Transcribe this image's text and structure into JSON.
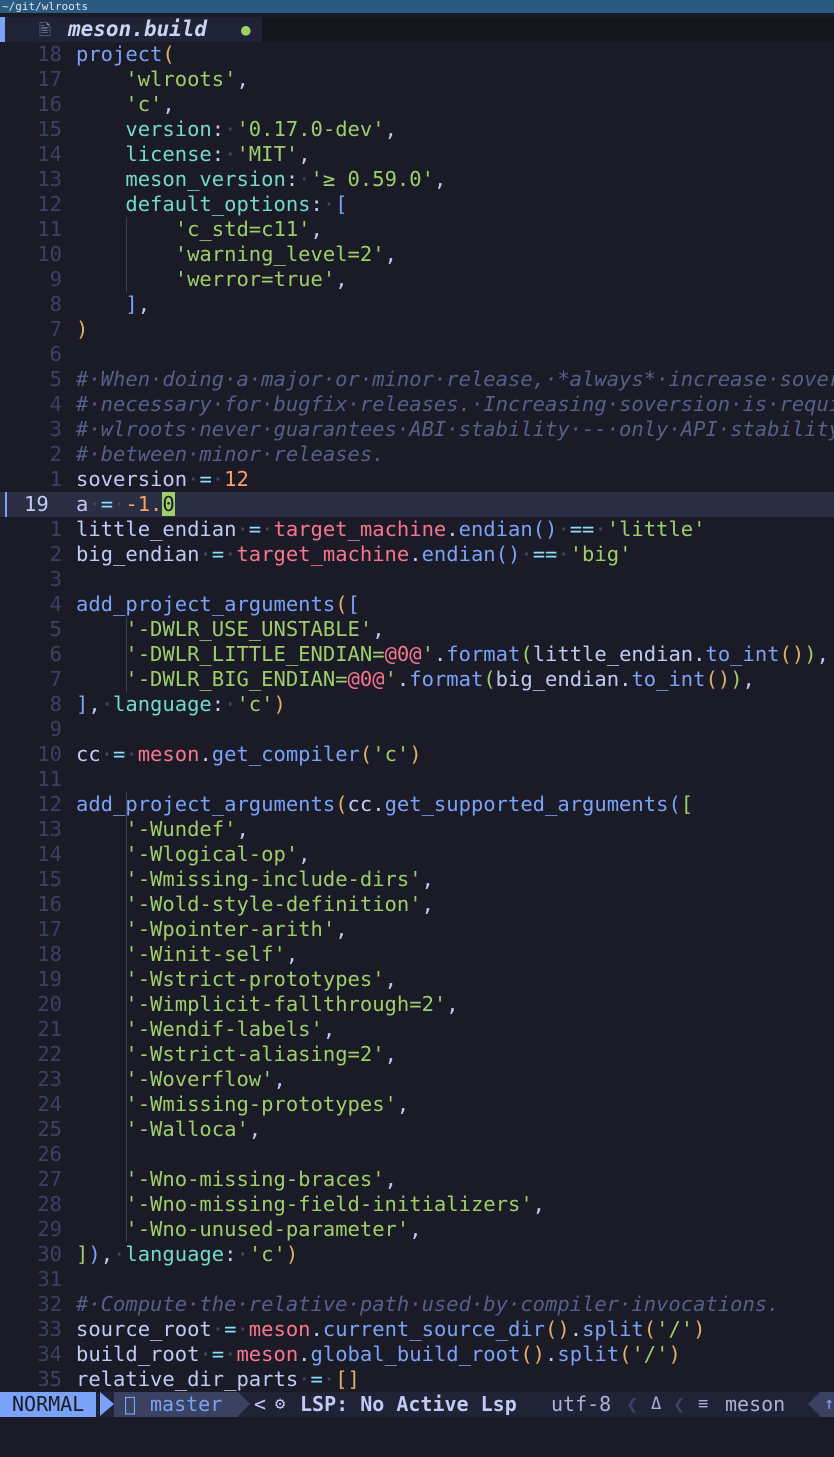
{
  "window": {
    "title": "~/git/wlroots"
  },
  "tab": {
    "file_icon": "🖹",
    "name": "meson.build",
    "modified": "●"
  },
  "lines": [
    {
      "ln": "18",
      "html": "<span class='fn'>project</span><span class='br'>(</span>"
    },
    {
      "ln": "17",
      "html": "    <span class='str'>'wlroots'</span>,"
    },
    {
      "ln": "16",
      "html": "    <span class='str'>'c'</span>,"
    },
    {
      "ln": "15",
      "html": "    <span class='key'>version</span>:<span class='dot'>·</span><span class='str'>'0.17.0-dev'</span>,"
    },
    {
      "ln": "14",
      "html": "    <span class='key'>license</span>:<span class='dot'>·</span><span class='str'>'MIT'</span>,"
    },
    {
      "ln": "13",
      "html": "    <span class='key'>meson_version</span>:<span class='dot'>·</span><span class='str'>'≥ 0.59.0'</span>,"
    },
    {
      "ln": "12",
      "html": "    <span class='key'>default_options</span>:<span class='dot'>·</span><span class='br2'>[</span>"
    },
    {
      "ln": "11",
      "html": "        <span class='str'>'c_std=c11'</span>,"
    },
    {
      "ln": "10",
      "html": "        <span class='str'>'warning_level=2'</span>,"
    },
    {
      "ln": "9",
      "html": "        <span class='str'>'werror=true'</span>,"
    },
    {
      "ln": "8",
      "html": "    <span class='br2'>]</span>,"
    },
    {
      "ln": "7",
      "html": "<span class='br'>)</span>"
    },
    {
      "ln": "6",
      "html": ""
    },
    {
      "ln": "5",
      "html": "<span class='cmt'>#·When·doing·a·major·or·minor·release,·*always*·increase·soversion.</span>"
    },
    {
      "ln": "4",
      "html": "<span class='cmt'>#·necessary·for·bugfix·releases.·Increasing·soversion·is·required</span>"
    },
    {
      "ln": "3",
      "html": "<span class='cmt'>#·wlroots·never·guarantees·ABI·stability·--·only·API·stability·is</span>"
    },
    {
      "ln": "2",
      "html": "<span class='cmt'>#·between·minor·releases.</span>"
    },
    {
      "ln": "1",
      "html": "<span class='var'>soversion</span><span class='dot'>·</span><span class='op'>=</span><span class='dot'>·</span><span class='num'>12</span>"
    },
    {
      "ln": "19",
      "current": true,
      "html": "<span class='var'>a</span><span class='dot'>·</span><span class='op'>=</span><span class='dot'>·</span><span class='num'>-1.</span><span class='cursor'>0</span>"
    },
    {
      "ln": "1",
      "html": "<span class='var'>little_endian</span><span class='dot'>·</span><span class='op'>=</span><span class='dot'>·</span><span class='obj'>target_machine</span>.<span class='fn'>endian</span><span class='br2'>()</span><span class='dot'>·</span><span class='op'>==</span><span class='dot'>·</span><span class='str'>'little'</span>"
    },
    {
      "ln": "2",
      "html": "<span class='var'>big_endian</span><span class='dot'>·</span><span class='op'>=</span><span class='dot'>·</span><span class='obj'>target_machine</span>.<span class='fn'>endian</span><span class='br2'>()</span><span class='dot'>·</span><span class='op'>==</span><span class='dot'>·</span><span class='str'>'big'</span>"
    },
    {
      "ln": "3",
      "html": ""
    },
    {
      "ln": "4",
      "html": "<span class='fn'>add_project_arguments</span><span class='br'>(</span><span class='br2'>[</span>"
    },
    {
      "ln": "5",
      "html": "    <span class='str'>'-DWLR_USE_UNSTABLE'</span>,"
    },
    {
      "ln": "6",
      "html": "    <span class='str'>'-DWLR_LITTLE_ENDIAN=</span><span class='esc'>@0@</span><span class='str'>'</span>.<span class='fn'>format</span><span class='br3'>(</span><span class='var'>little_endian</span>.<span class='fn'>to_int</span><span class='br'>()</span><span class='br3'>)</span>,"
    },
    {
      "ln": "7",
      "html": "    <span class='str'>'-DWLR_BIG_ENDIAN=</span><span class='esc'>@0@</span><span class='str'>'</span>.<span class='fn'>format</span><span class='br3'>(</span><span class='var'>big_endian</span>.<span class='fn'>to_int</span><span class='br'>()</span><span class='br3'>)</span>,"
    },
    {
      "ln": "8",
      "html": "<span class='br2'>]</span>,<span class='dot'>·</span><span class='key'>language</span>:<span class='dot'>·</span><span class='str'>'c'</span><span class='br'>)</span>"
    },
    {
      "ln": "9",
      "html": ""
    },
    {
      "ln": "10",
      "html": "<span class='var'>cc</span><span class='dot'>·</span><span class='op'>=</span><span class='dot'>·</span><span class='obj'>meson</span>.<span class='fn'>get_compiler</span><span class='br'>(</span><span class='str'>'c'</span><span class='br'>)</span>"
    },
    {
      "ln": "11",
      "html": ""
    },
    {
      "ln": "12",
      "html": "<span class='fn'>add_project_arguments</span><span class='br'>(</span><span class='var'>cc</span>.<span class='fn'>get_supported_arguments</span><span class='br2'>(</span><span class='br3'>[</span>"
    },
    {
      "ln": "13",
      "html": "    <span class='str'>'-Wundef'</span>,"
    },
    {
      "ln": "14",
      "html": "    <span class='str'>'-Wlogical-op'</span>,"
    },
    {
      "ln": "15",
      "html": "    <span class='str'>'-Wmissing-include-dirs'</span>,"
    },
    {
      "ln": "16",
      "html": "    <span class='str'>'-Wold-style-definition'</span>,"
    },
    {
      "ln": "17",
      "html": "    <span class='str'>'-Wpointer-arith'</span>,"
    },
    {
      "ln": "18",
      "html": "    <span class='str'>'-Winit-self'</span>,"
    },
    {
      "ln": "19",
      "html": "    <span class='str'>'-Wstrict-prototypes'</span>,"
    },
    {
      "ln": "20",
      "html": "    <span class='str'>'-Wimplicit-fallthrough=2'</span>,"
    },
    {
      "ln": "21",
      "html": "    <span class='str'>'-Wendif-labels'</span>,"
    },
    {
      "ln": "22",
      "html": "    <span class='str'>'-Wstrict-aliasing=2'</span>,"
    },
    {
      "ln": "23",
      "html": "    <span class='str'>'-Woverflow'</span>,"
    },
    {
      "ln": "24",
      "html": "    <span class='str'>'-Wmissing-prototypes'</span>,"
    },
    {
      "ln": "25",
      "html": "    <span class='str'>'-Walloca'</span>,"
    },
    {
      "ln": "26",
      "html": ""
    },
    {
      "ln": "27",
      "html": "    <span class='str'>'-Wno-missing-braces'</span>,"
    },
    {
      "ln": "28",
      "html": "    <span class='str'>'-Wno-missing-field-initializers'</span>,"
    },
    {
      "ln": "29",
      "html": "    <span class='str'>'-Wno-unused-parameter'</span>,"
    },
    {
      "ln": "30",
      "html": "<span class='br3'>]</span><span class='br2'>)</span>,<span class='dot'>·</span><span class='key'>language</span>:<span class='dot'>·</span><span class='str'>'c'</span><span class='br'>)</span>"
    },
    {
      "ln": "31",
      "html": ""
    },
    {
      "ln": "32",
      "html": "<span class='cmt'>#·Compute·the·relative·path·used·by·compiler·invocations.</span>"
    },
    {
      "ln": "33",
      "html": "<span class='var'>source_root</span><span class='dot'>·</span><span class='op'>=</span><span class='dot'>·</span><span class='obj'>meson</span>.<span class='fn'>current_source_dir</span><span class='br'>()</span>.<span class='fn'>split</span><span class='br'>(</span><span class='str'>'/'</span><span class='br'>)</span>"
    },
    {
      "ln": "34",
      "html": "<span class='var'>build_root</span><span class='dot'>·</span><span class='op'>=</span><span class='dot'>·</span><span class='obj'>meson</span>.<span class='fn'>global_build_root</span><span class='br'>()</span>.<span class='fn'>split</span><span class='br'>(</span><span class='str'>'/'</span><span class='br'>)</span>"
    },
    {
      "ln": "35",
      "html": "<span class='var'>relative_dir_parts</span><span class='dot'>·</span><span class='op'>=</span><span class='dot'>·</span><span class='br'>[]</span>"
    }
  ],
  "statusline": {
    "mode": "NORMAL",
    "branch_icon": "",
    "branch": "master",
    "lsp_sep": "<",
    "lsp_icon": "⚙",
    "lsp": "LSP: No Active Lsp",
    "encoding": "utf-8",
    "sep1": "❮",
    "os_icon": "Δ",
    "sep2": "❮",
    "filetype_icon": "≡",
    "filetype": "meson",
    "ft_end": "↑"
  },
  "colors": {
    "bg": "#1a1b26",
    "accent": "#7aa2f7",
    "string": "#9ece6a",
    "number": "#ff9e64",
    "comment": "#565f89"
  }
}
